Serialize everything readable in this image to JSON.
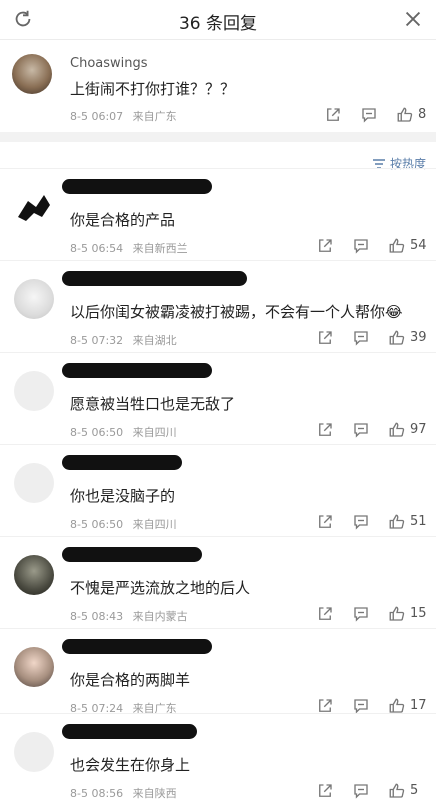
{
  "header": {
    "title": "36 条回复"
  },
  "original": {
    "username": "Choaswings",
    "text": "上街闹不打你打谁？？？",
    "time": "8-5 06:07",
    "source": "来自广东",
    "likes": "8"
  },
  "sort": {
    "label": "按热度"
  },
  "comments": [
    {
      "text": "你是合格的产品",
      "time": "8-5 06:54",
      "source": "来自新西兰",
      "likes": "54"
    },
    {
      "text": "以后你闺女被霸凌被打被踢，不会有一个人帮你",
      "emoji": "😂",
      "time": "8-5 07:32",
      "source": "来自湖北",
      "likes": "39"
    },
    {
      "text": "愿意被当牲口也是无敌了",
      "time": "8-5 06:50",
      "source": "来自四川",
      "likes": "97"
    },
    {
      "text": "你也是没脑子的",
      "time": "8-5 06:50",
      "source": "来自四川",
      "likes": "51"
    },
    {
      "text": "不愧是严选流放之地的后人",
      "time": "8-5 08:43",
      "source": "来自内蒙古",
      "likes": "15"
    },
    {
      "text": "你是合格的两脚羊",
      "time": "8-5 07:24",
      "source": "来自广东",
      "likes": "17"
    },
    {
      "text": "也会发生在你身上",
      "time": "8-5 08:56",
      "source": "来自陕西",
      "likes": "5"
    }
  ],
  "colors": {
    "accent": "#5a7ea9",
    "text": "#222222",
    "meta": "#9a9a9a",
    "divider": "#f2f2f2"
  },
  "icons": [
    "refresh-icon",
    "close-icon",
    "share-icon",
    "comment-icon",
    "like-icon",
    "sort-icon"
  ]
}
